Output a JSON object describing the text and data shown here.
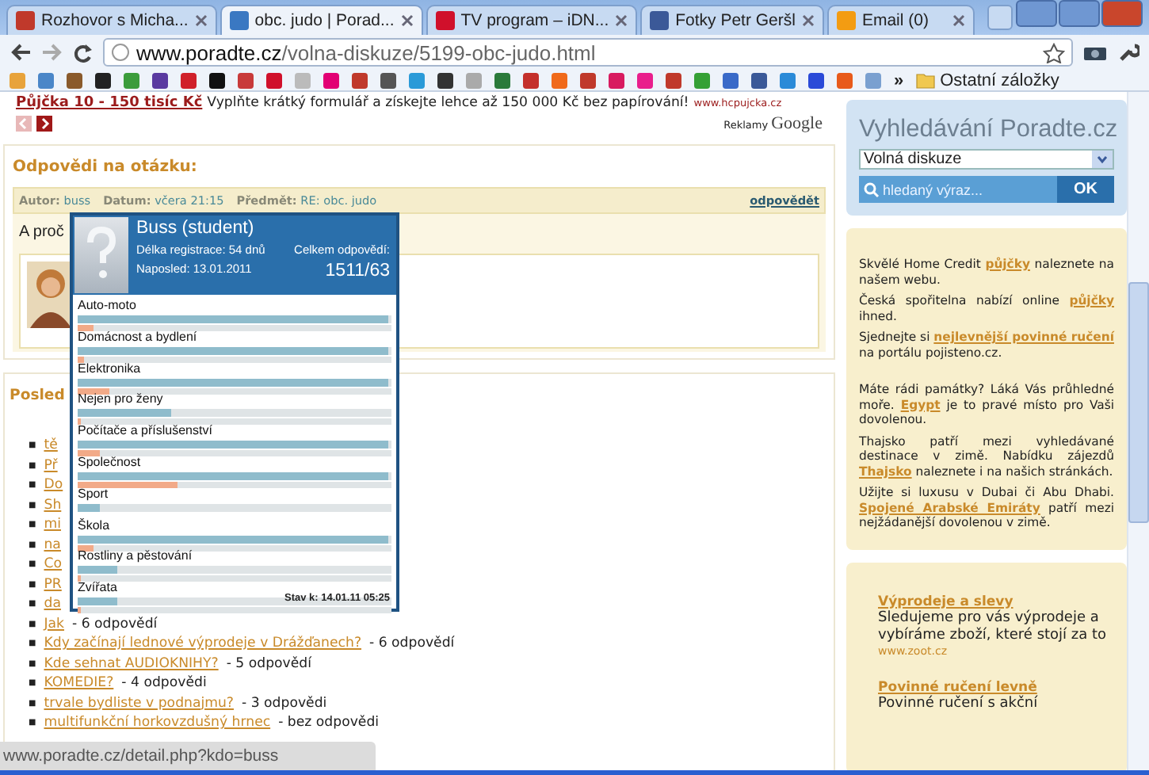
{
  "browser": {
    "tabs": [
      {
        "title": "Rozhovor s Micha...",
        "selected": false
      },
      {
        "title": "obc. judo | Porad...",
        "selected": true
      },
      {
        "title": "TV program – iDN...",
        "selected": false
      },
      {
        "title": "Fotky Petr Geršl",
        "selected": false
      },
      {
        "title": "Email (0)",
        "selected": false
      }
    ],
    "address": {
      "host": "www.poradte.cz",
      "path": "/volna-diskuze/5199-obc-judo.html"
    },
    "bookmarks": {
      "more": "»",
      "folder": "Ostatní záložky"
    }
  },
  "ad": {
    "link": "Půjčka 10 - 150 tisíc Kč",
    "text": "Vyplňte krátký formulář a získejte lehce až 150 000 Kč bez papírování!",
    "url": "www.hcpujcka.cz",
    "by": "Reklamy",
    "brand": "Google"
  },
  "answers": {
    "heading": "Odpovědi na otázku:",
    "meta": [
      {
        "label": "Autor:",
        "value": "buss"
      },
      {
        "label": "Datum:",
        "value": "včera 21:15"
      },
      {
        "label": "Předmět:",
        "value": "RE: obc. judo"
      }
    ],
    "reply": "odpovědět",
    "text": "A proč"
  },
  "profile_popup": {
    "name": "Buss (student)",
    "registration": "Délka registrace: 54 dnů",
    "last_seen": "Naposled: 13.01.2011",
    "total_label": "Celkem odpovědí:",
    "total": "1511/63",
    "categories": [
      {
        "label": "Auto-moto",
        "bars": [
          {
            "level": 1.0
          },
          {
            "level": 0.05
          }
        ]
      },
      {
        "label": "Domácnost a bydlení",
        "bars": [
          {
            "level": 1.0
          },
          {
            "level": 0.02
          }
        ]
      },
      {
        "label": "Elektronika",
        "bars": [
          {
            "level": 1.0
          },
          {
            "level": 0.1
          }
        ]
      },
      {
        "label": "Nejen pro ženy",
        "bars": [
          {
            "level": 0.3
          },
          {
            "level": 0.01
          }
        ]
      },
      {
        "label": "Počítače a příslušenství",
        "bars": [
          {
            "level": 1.0
          },
          {
            "level": 0.07
          }
        ]
      },
      {
        "label": "Společnost",
        "bars": [
          {
            "level": 1.0
          },
          {
            "level": 0.32
          }
        ]
      },
      {
        "label": "Sport",
        "bars": [
          {
            "level": 0.07
          }
        ]
      },
      {
        "label": "Škola",
        "bars": [
          {
            "level": 1.0
          },
          {
            "level": 0.05
          }
        ]
      },
      {
        "label": "Rostliny a pěstování",
        "bars": [
          {
            "level": 0.13
          },
          {
            "level": 0.01
          }
        ]
      },
      {
        "label": "Zvířata",
        "bars": [
          {
            "level": 0.13
          },
          {
            "level": 0.01
          }
        ]
      }
    ],
    "footer": "Stav k: 14.01.11 05:25"
  },
  "recent": {
    "heading": "Posled",
    "bullet": "■",
    "items": [
      {
        "link": "tě"
      },
      {
        "link": "Př"
      },
      {
        "link": "Do"
      },
      {
        "link": "Sh"
      },
      {
        "link": "mi"
      },
      {
        "link": "na"
      },
      {
        "link": "Co"
      },
      {
        "link": "PR"
      },
      {
        "link": "da"
      },
      {
        "link": "Jak",
        "suffix": "- 6 odpovědí"
      },
      {
        "link": "Kdy začínají lednové výprodeje v Drážďanech?",
        "suffix": "- 6 odpovědí"
      },
      {
        "link": "Kde sehnat AUDIOKNIHY?",
        "suffix": "- 5 odpovědí"
      },
      {
        "link": "KOMEDIE?",
        "suffix": "- 4 odpovědi"
      },
      {
        "link": "trvale bydliste v podnajmu?",
        "suffix": "- 3 odpovědi"
      },
      {
        "link": "multifunkční horkovzdušný hrnec",
        "suffix": "- bez odpovědi"
      }
    ]
  },
  "sidebar": {
    "search": {
      "title": "Vyhledávání Poradte.cz",
      "category": "Volná diskuze",
      "placeholder": "hledaný výraz...",
      "button": "OK"
    },
    "promo": [
      [
        {
          "text": "Skvělé Home Credit "
        },
        {
          "link": "půjčky"
        },
        {
          "text": " naleznete na našem webu."
        }
      ],
      [
        {
          "text": "Česká spořitelna nabízí online "
        },
        {
          "link": "půjčky"
        },
        {
          "text": " ihned."
        }
      ],
      [
        {
          "text": "Sjednejte si "
        },
        {
          "link": "nejlevnější povinné ručení"
        },
        {
          "text": " na portálu pojisteno.cz."
        }
      ],
      [
        {
          "text": "Máte rádi památky? Láká Vás průhledné moře. "
        },
        {
          "link": "Egypt"
        },
        {
          "text": " je to pravé místo pro Vaši dovolenou."
        }
      ],
      [
        {
          "text": "Thajsko patří mezi vyhledávané destinace v zimě. Nabídku zájezdů "
        },
        {
          "link": "Thajsko"
        },
        {
          "text": " naleznete i na našich stránkách."
        }
      ],
      [
        {
          "text": "Užijte si luxusu v Dubai či Abu Dhabi. "
        },
        {
          "link": "Spojené Arabské Emiráty"
        },
        {
          "text": " patří mezi nejžádanější dovolenou v zimě."
        }
      ]
    ],
    "ads": [
      {
        "title": "Výprodeje a slevy",
        "text": "Sledujeme pro vás výprodeje a vybíráme zboží, které stojí za to",
        "url": "www.zoot.cz"
      },
      {
        "title": "Povinné ručení levně",
        "text": "Povinné ručení s akční"
      }
    ]
  },
  "status_bar": "www.poradte.cz/detail.php?kdo=buss"
}
